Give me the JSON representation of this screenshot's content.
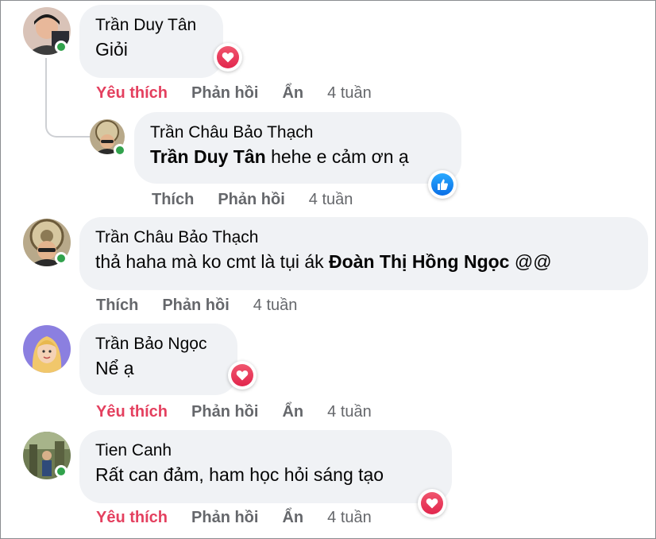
{
  "comments": [
    {
      "author": "Trần Duy Tân",
      "text": "Giỏi",
      "reaction": "heart",
      "actions": {
        "like": "Yêu thích",
        "reply": "Phản hồi",
        "hide": "Ẩn",
        "time": "4 tuần"
      }
    },
    {
      "author": "Trần Châu Bảo Thạch",
      "mention": "Trần Duy Tân",
      "text": " hehe e cảm ơn ạ",
      "reaction": "like",
      "actions": {
        "like": "Thích",
        "reply": "Phản hồi",
        "time": "4 tuần"
      }
    },
    {
      "author": "Trần Châu Bảo Thạch",
      "text": "thả haha mà ko cmt là tụi ák ",
      "mention": "Đoàn Thị Hồng Ngọc",
      "text_after": " @@",
      "actions": {
        "like": "Thích",
        "reply": "Phản hồi",
        "time": "4 tuần"
      }
    },
    {
      "author": "Trần Bảo Ngọc",
      "text": "Nể ạ",
      "reaction": "heart",
      "actions": {
        "like": "Yêu thích",
        "reply": "Phản hồi",
        "hide": "Ẩn",
        "time": "4 tuần"
      }
    },
    {
      "author": "Tien Canh",
      "text": "Rất can đảm, ham học hỏi sáng tạo",
      "reaction": "heart",
      "actions": {
        "like": "Yêu thích",
        "reply": "Phản hồi",
        "hide": "Ẩn",
        "time": "4 tuần"
      }
    }
  ],
  "colors": {
    "bubble": "#f0f2f5",
    "liked": "#e4405f",
    "muted": "#65676b",
    "online": "#31a24c",
    "heart": "#e2264d",
    "like": "#0a6ee6"
  },
  "icons": {
    "heart": "heart-icon",
    "like": "thumbs-up-icon"
  }
}
